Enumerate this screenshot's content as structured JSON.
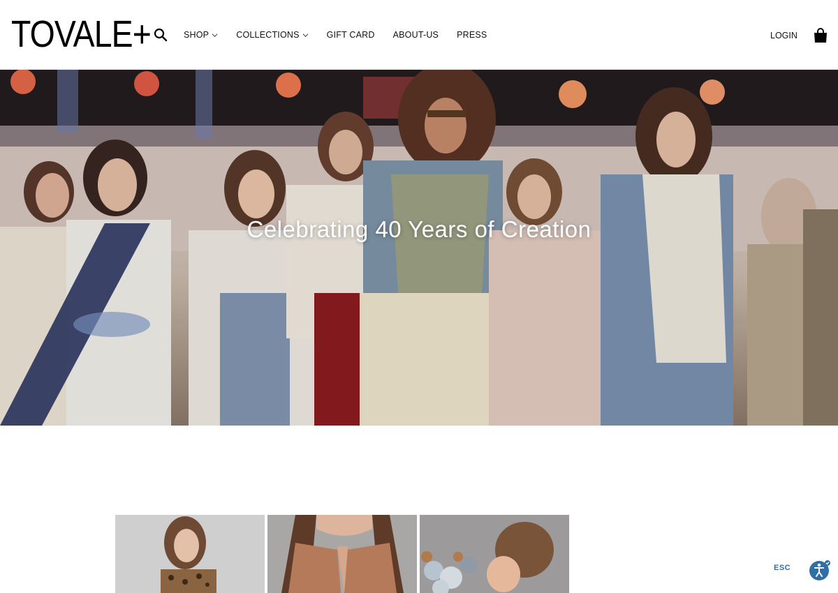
{
  "header": {
    "logo": "TOVALE+",
    "nav": [
      {
        "label": "SHOP",
        "has_dropdown": true
      },
      {
        "label": "COLLECTIONS",
        "has_dropdown": true
      },
      {
        "label": "GIFT CARD",
        "has_dropdown": false
      },
      {
        "label": "ABOUT-US",
        "has_dropdown": false
      },
      {
        "label": "PRESS",
        "has_dropdown": false
      }
    ],
    "login_label": "LOGIN",
    "icons": {
      "search": "search-icon",
      "cart": "shopping-bag-icon"
    }
  },
  "hero": {
    "title": "Celebrating 40 Years of Creation",
    "image": "runway-models-photo"
  },
  "products": [
    {
      "image": "model-leopard-print-photo"
    },
    {
      "image": "model-sequin-top-photo"
    },
    {
      "image": "model-flowers-photo"
    }
  ],
  "accessibility": {
    "esc_label": "ESC",
    "icon": "accessibility-icon",
    "color": "#2f6fa6"
  }
}
